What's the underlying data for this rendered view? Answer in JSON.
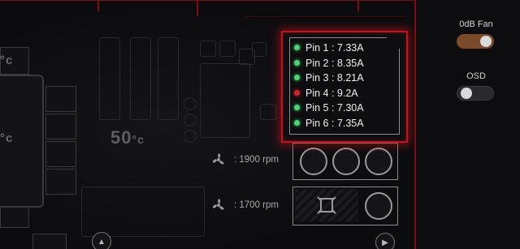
{
  "pins": [
    {
      "label": "Pin 1 : 7.33A",
      "status": "ok"
    },
    {
      "label": "Pin 2 : 8.35A",
      "status": "ok"
    },
    {
      "label": "Pin 3 : 8.21A",
      "status": "ok"
    },
    {
      "label": "Pin 4 : 9.2A",
      "status": "warning"
    },
    {
      "label": "Pin 5 : 7.30A",
      "status": "ok"
    },
    {
      "label": "Pin 6 : 7.35A",
      "status": "ok"
    }
  ],
  "board": {
    "gpu_temp": "50",
    "temp_unit": "°c",
    "left_temp_1": "°c",
    "left_temp_2": "°c"
  },
  "fans": [
    {
      "speed": ": 1900 rpm"
    },
    {
      "speed": ": 1700 rpm"
    }
  ],
  "settings": {
    "zero_db_label": "0dB Fan",
    "zero_db_state": "on",
    "osd_label": "OSD",
    "osd_state": "off"
  },
  "colors": {
    "ok": "#49d670",
    "warning": "#d3242a",
    "accent": "#c3141c"
  },
  "icons": {
    "scroll_up": "chevron-up-icon",
    "play": "play-icon"
  }
}
